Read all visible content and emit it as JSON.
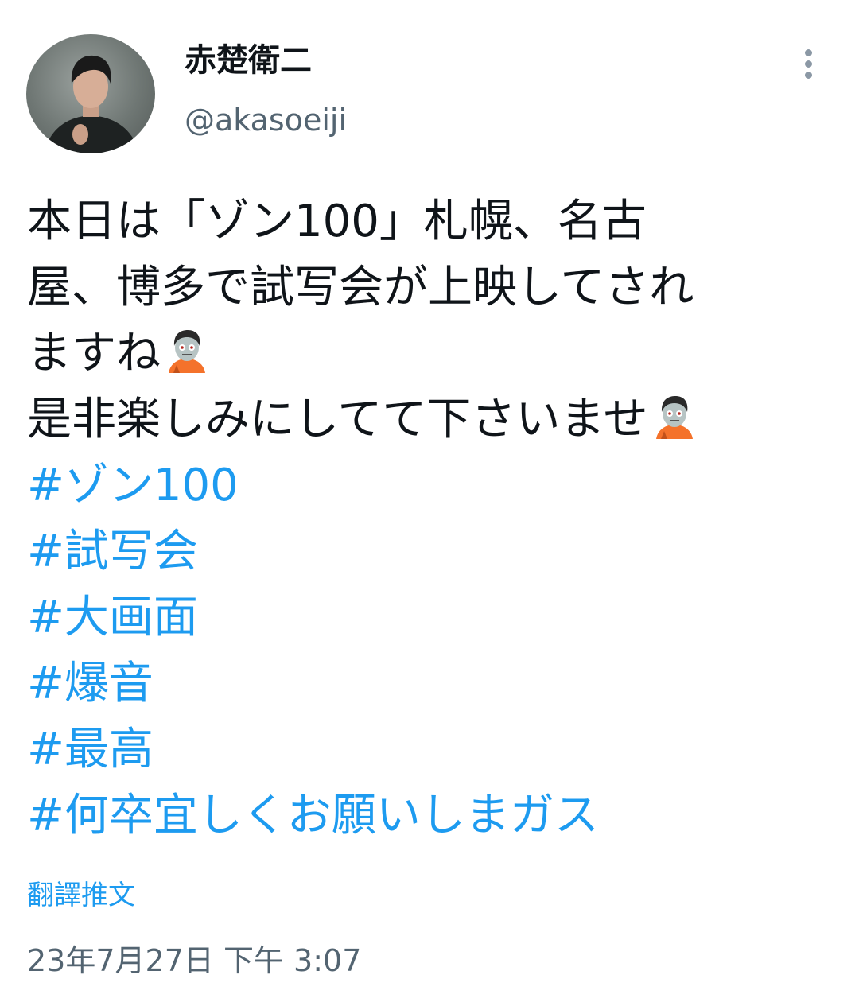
{
  "author": {
    "display_name": "赤楚衛二",
    "handle": "@akasoeiji"
  },
  "tweet": {
    "lines": [
      "本日は「ゾン100」札幌、名古",
      "屋、博多で試写会が上映してされ",
      "ますね",
      "是非楽しみにしてて下さいませ"
    ],
    "hashtags": [
      "#ゾン100",
      "#試写会",
      "#大画面",
      "#爆音",
      "#最高",
      "#何卒宜しくお願いしまガス"
    ],
    "translate_label": "翻譯推文",
    "timestamp": "23年7月27日 下午 3:07"
  },
  "icons": {
    "more": "more-vertical-icon",
    "emoji": "zombie-emoji-icon"
  },
  "colors": {
    "link": "#1d9bf0",
    "secondary_text": "#536471",
    "primary_text": "#0f1419"
  }
}
